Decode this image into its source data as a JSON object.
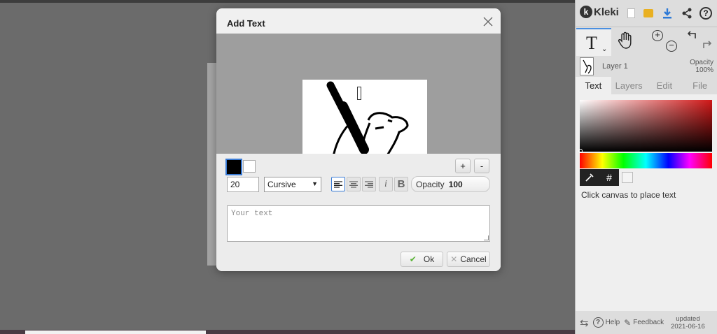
{
  "app": {
    "name": "Kleki"
  },
  "toolbar_icons": [
    "new-image-icon",
    "open-folder-icon",
    "download-icon",
    "share-icon",
    "help-icon"
  ],
  "layer": {
    "name": "Layer 1",
    "opacity_label": "Opacity",
    "opacity_value": "100%"
  },
  "tabs": [
    "Text",
    "Layers",
    "Edit",
    "File"
  ],
  "picker": {
    "hex_button": "#"
  },
  "text_hint": "Click canvas to place text",
  "footer": {
    "help": "Help",
    "feedback": "Feedback",
    "updated_label": "updated",
    "updated_date": "2021-06-16"
  },
  "dialog": {
    "title": "Add Text",
    "plus": "+",
    "minus": "-",
    "size": "20",
    "font": "Cursive",
    "opacity_label": "Opacity",
    "opacity_value": "100",
    "placeholder": "Your text",
    "ok": "Ok",
    "cancel": "Cancel"
  },
  "colors": {
    "primary": "#000000",
    "secondary": "#ffffff",
    "accent": "#3a7bd5",
    "ok_check": "#5bb437"
  }
}
